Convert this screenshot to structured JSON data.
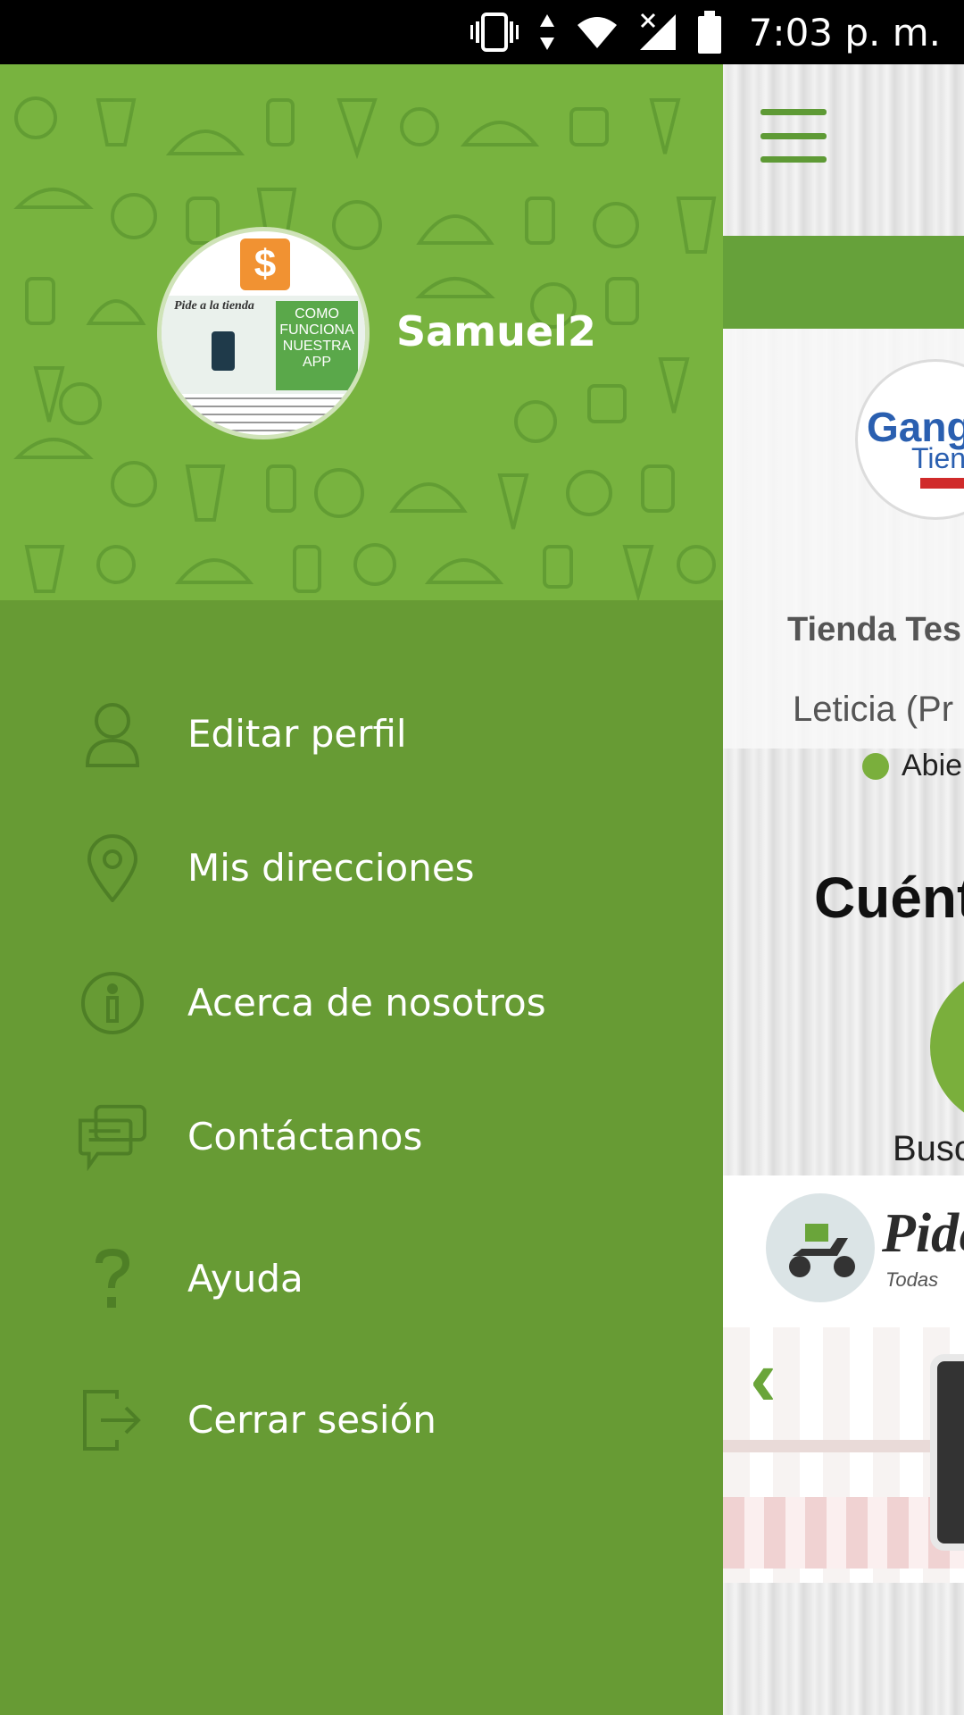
{
  "status_bar": {
    "time": "7:03 p. m.",
    "icons": [
      "vibrate-icon",
      "data-arrows-icon",
      "wifi-icon",
      "no-signal-icon",
      "battery-icon"
    ]
  },
  "drawer": {
    "header": {
      "username": "Samuel2",
      "avatar_icon": "profile-picture",
      "avatar_banner_title": "Pide a la tienda",
      "avatar_banner_text": "COMO FUNCIONA NUESTRA APP"
    },
    "menu": [
      {
        "label": "Editar perfil",
        "icon": "user-icon"
      },
      {
        "label": "Mis direcciones",
        "icon": "location-pin-icon"
      },
      {
        "label": "Acerca de nosotros",
        "icon": "info-icon"
      },
      {
        "label": "Contáctanos",
        "icon": "chat-bubbles-icon"
      },
      {
        "label": "Ayuda",
        "icon": "help-question-icon"
      },
      {
        "label": "Cerrar sesión",
        "icon": "logout-icon"
      }
    ]
  },
  "background_app": {
    "store_logo_text_1": "Gang",
    "store_logo_text_2": "Tien",
    "store_name": "Tienda Tes",
    "store_location": "Leticia (Pr",
    "store_status": "Abie",
    "heading": "Cuént",
    "action_label": "Busc",
    "banner_title": "Pide",
    "banner_subtitle": "Todas"
  },
  "colors": {
    "drawer_bg": "#679b34",
    "drawer_header_bg": "#78b33f",
    "accent_green": "#7aaf3c",
    "status_bar_bg": "#000000"
  }
}
